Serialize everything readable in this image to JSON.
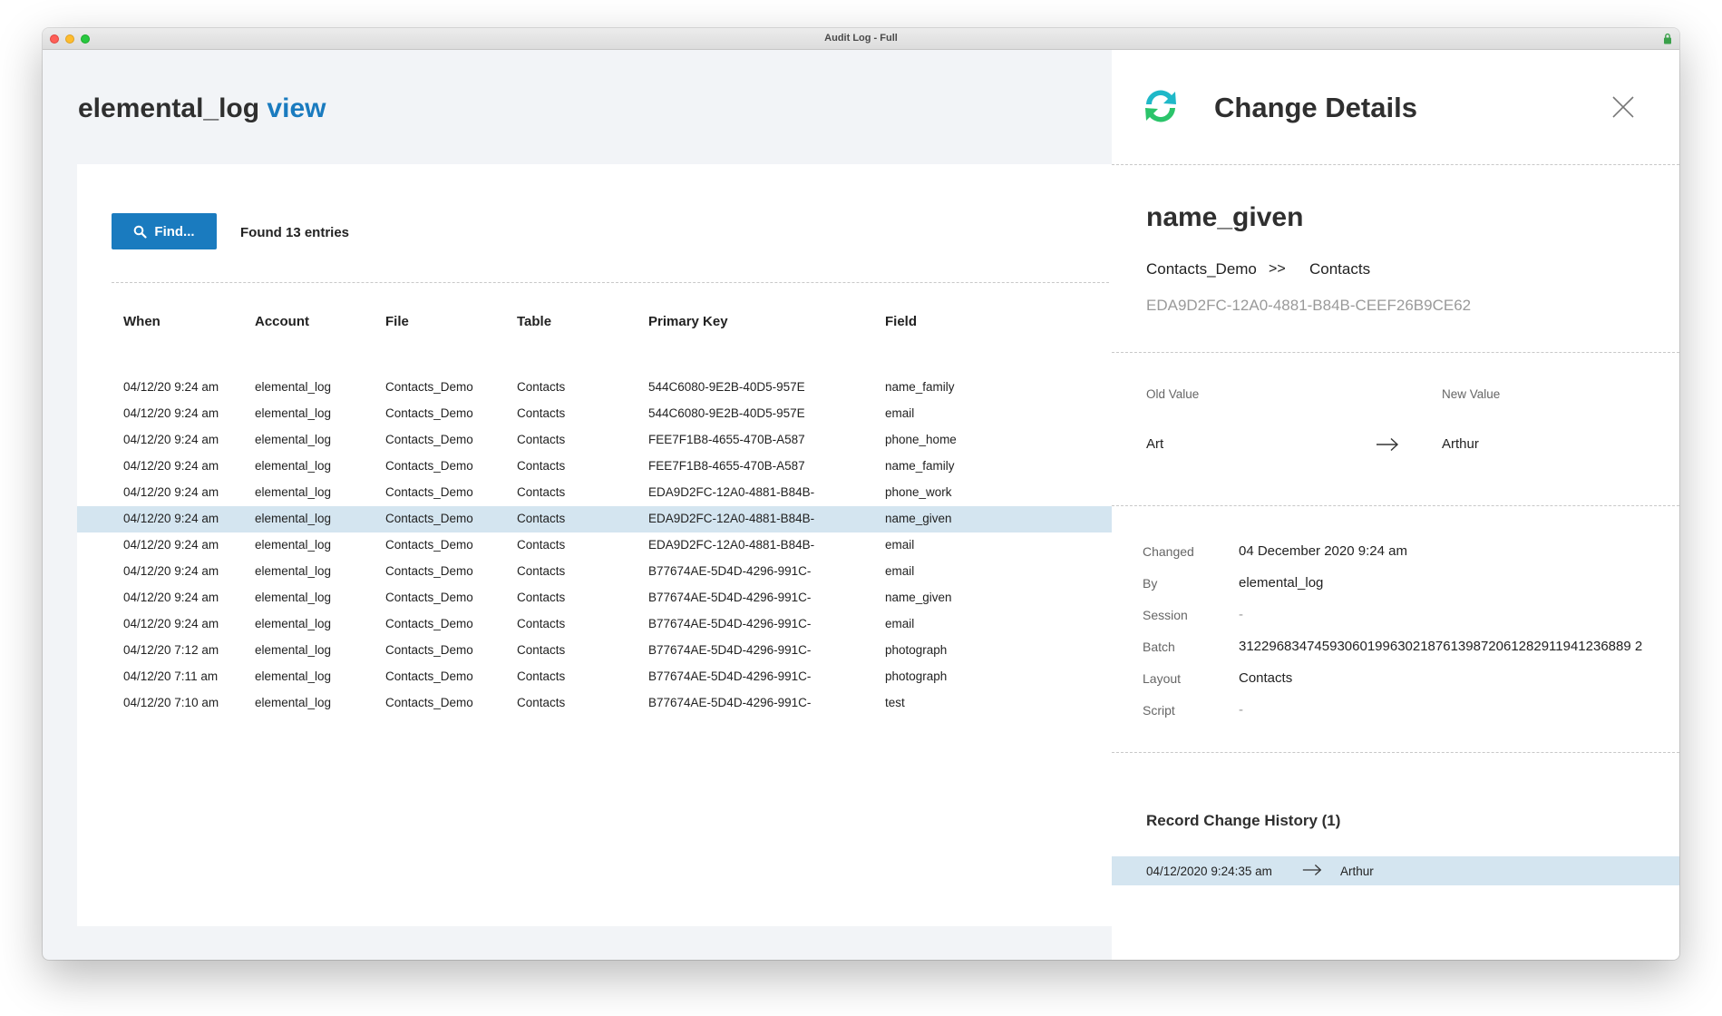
{
  "window": {
    "title": "Audit Log - Full"
  },
  "main": {
    "title_prefix": "elemental_log",
    "title_accent": "view",
    "find_label": "Find...",
    "found_text": "Found 13 entries",
    "columns": [
      "When",
      "Account",
      "File",
      "Table",
      "Primary Key",
      "Field"
    ],
    "selected_row": 5,
    "rows": [
      [
        "04/12/20 9:24 am",
        "elemental_log",
        "Contacts_Demo",
        "Contacts",
        "544C6080-9E2B-40D5-957E",
        "name_family"
      ],
      [
        "04/12/20 9:24 am",
        "elemental_log",
        "Contacts_Demo",
        "Contacts",
        "544C6080-9E2B-40D5-957E",
        "email"
      ],
      [
        "04/12/20 9:24 am",
        "elemental_log",
        "Contacts_Demo",
        "Contacts",
        "FEE7F1B8-4655-470B-A587",
        "phone_home"
      ],
      [
        "04/12/20 9:24 am",
        "elemental_log",
        "Contacts_Demo",
        "Contacts",
        "FEE7F1B8-4655-470B-A587",
        "name_family"
      ],
      [
        "04/12/20 9:24 am",
        "elemental_log",
        "Contacts_Demo",
        "Contacts",
        "EDA9D2FC-12A0-4881-B84B-",
        "phone_work"
      ],
      [
        "04/12/20 9:24 am",
        "elemental_log",
        "Contacts_Demo",
        "Contacts",
        "EDA9D2FC-12A0-4881-B84B-",
        "name_given"
      ],
      [
        "04/12/20 9:24 am",
        "elemental_log",
        "Contacts_Demo",
        "Contacts",
        "EDA9D2FC-12A0-4881-B84B-",
        "email"
      ],
      [
        "04/12/20 9:24 am",
        "elemental_log",
        "Contacts_Demo",
        "Contacts",
        "B77674AE-5D4D-4296-991C-",
        "email"
      ],
      [
        "04/12/20 9:24 am",
        "elemental_log",
        "Contacts_Demo",
        "Contacts",
        "B77674AE-5D4D-4296-991C-",
        "name_given"
      ],
      [
        "04/12/20 9:24 am",
        "elemental_log",
        "Contacts_Demo",
        "Contacts",
        "B77674AE-5D4D-4296-991C-",
        "email"
      ],
      [
        "04/12/20 7:12 am",
        "elemental_log",
        "Contacts_Demo",
        "Contacts",
        "B77674AE-5D4D-4296-991C-",
        "photograph"
      ],
      [
        "04/12/20 7:11 am",
        "elemental_log",
        "Contacts_Demo",
        "Contacts",
        "B77674AE-5D4D-4296-991C-",
        "photograph"
      ],
      [
        "04/12/20 7:10 am",
        "elemental_log",
        "Contacts_Demo",
        "Contacts",
        "B77674AE-5D4D-4296-991C-",
        "test"
      ]
    ]
  },
  "panel": {
    "title": "Change Details",
    "field_name": "name_given",
    "file": "Contacts_Demo",
    "separator": ">>",
    "table": "Contacts",
    "primary_key": "EDA9D2FC-12A0-4881-B84B-CEEF26B9CE62",
    "old_value_label": "Old Value",
    "new_value_label": "New Value",
    "old_value": "Art",
    "new_value": "Arthur",
    "meta": {
      "changed_label": "Changed",
      "changed": "04 December 2020 9:24 am",
      "by_label": "By",
      "by": "elemental_log",
      "session_label": "Session",
      "session": "-",
      "batch_label": "Batch",
      "batch": "3122968347459306019963021876139872061282911941236889 2",
      "layout_label": "Layout",
      "layout": "Contacts",
      "script_label": "Script",
      "script": "-"
    },
    "history_title": "Record Change History (1)",
    "history": [
      {
        "time": "04/12/2020 9:24:35 am",
        "value": "Arthur"
      }
    ]
  },
  "colors": {
    "accent": "#1a7bbf",
    "selected_row": "#d4e5f0",
    "logo_teal": "#1fb8c8",
    "logo_green": "#2bc46a"
  },
  "icons": [
    "search-icon",
    "close-icon",
    "arrow-right-icon",
    "lock-icon",
    "app-logo-icon"
  ]
}
